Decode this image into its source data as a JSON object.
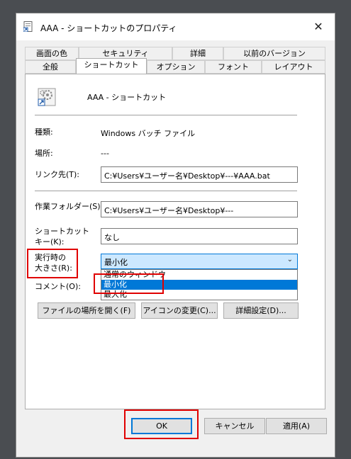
{
  "window": {
    "title": "AAA - ショートカットのプロパティ",
    "close_glyph": "✕"
  },
  "tabs": {
    "row1": [
      "画面の色",
      "セキュリティ",
      "詳細",
      "以前のバージョン"
    ],
    "row2": [
      "全般",
      "ショートカット",
      "オプション",
      "フォント",
      "レイアウト"
    ],
    "active": "ショートカット"
  },
  "shortcut": {
    "name": "AAA - ショートカット",
    "type_label": "種類:",
    "type_value": "Windows バッチ ファイル",
    "location_label": "場所:",
    "location_value": "---",
    "target_label": "リンク先(T):",
    "target_value": "C:¥Users¥ユーザー名¥Desktop¥---¥AAA.bat",
    "workdir_label": "作業フォルダー(S):",
    "workdir_value": "C:¥Users¥ユーザー名¥Desktop¥---",
    "hotkey_label_1": "ショートカット",
    "hotkey_label_2": "キー(K):",
    "hotkey_value": "なし",
    "run_label_1": "実行時の",
    "run_label_2": "大きさ(R):",
    "run_value": "最小化",
    "run_options": [
      "通常のウィンドウ",
      "最小化",
      "最大化"
    ],
    "run_selected_index": 1,
    "comment_label": "コメント(O):"
  },
  "buttons": {
    "open_location": "ファイルの場所を開く(F)",
    "change_icon": "アイコンの変更(C)...",
    "advanced": "詳細設定(D)...",
    "ok": "OK",
    "cancel": "キャンセル",
    "apply": "適用(A)"
  },
  "icons": {
    "window_icon": "shortcut-file-icon",
    "shortcut_icon": "batch-file-gear-icon",
    "combo_arrow": "chevron-down-icon"
  },
  "colors": {
    "highlight_box": "#e00000",
    "selection": "#0078d7",
    "combo_fill": "#cce8ff"
  }
}
